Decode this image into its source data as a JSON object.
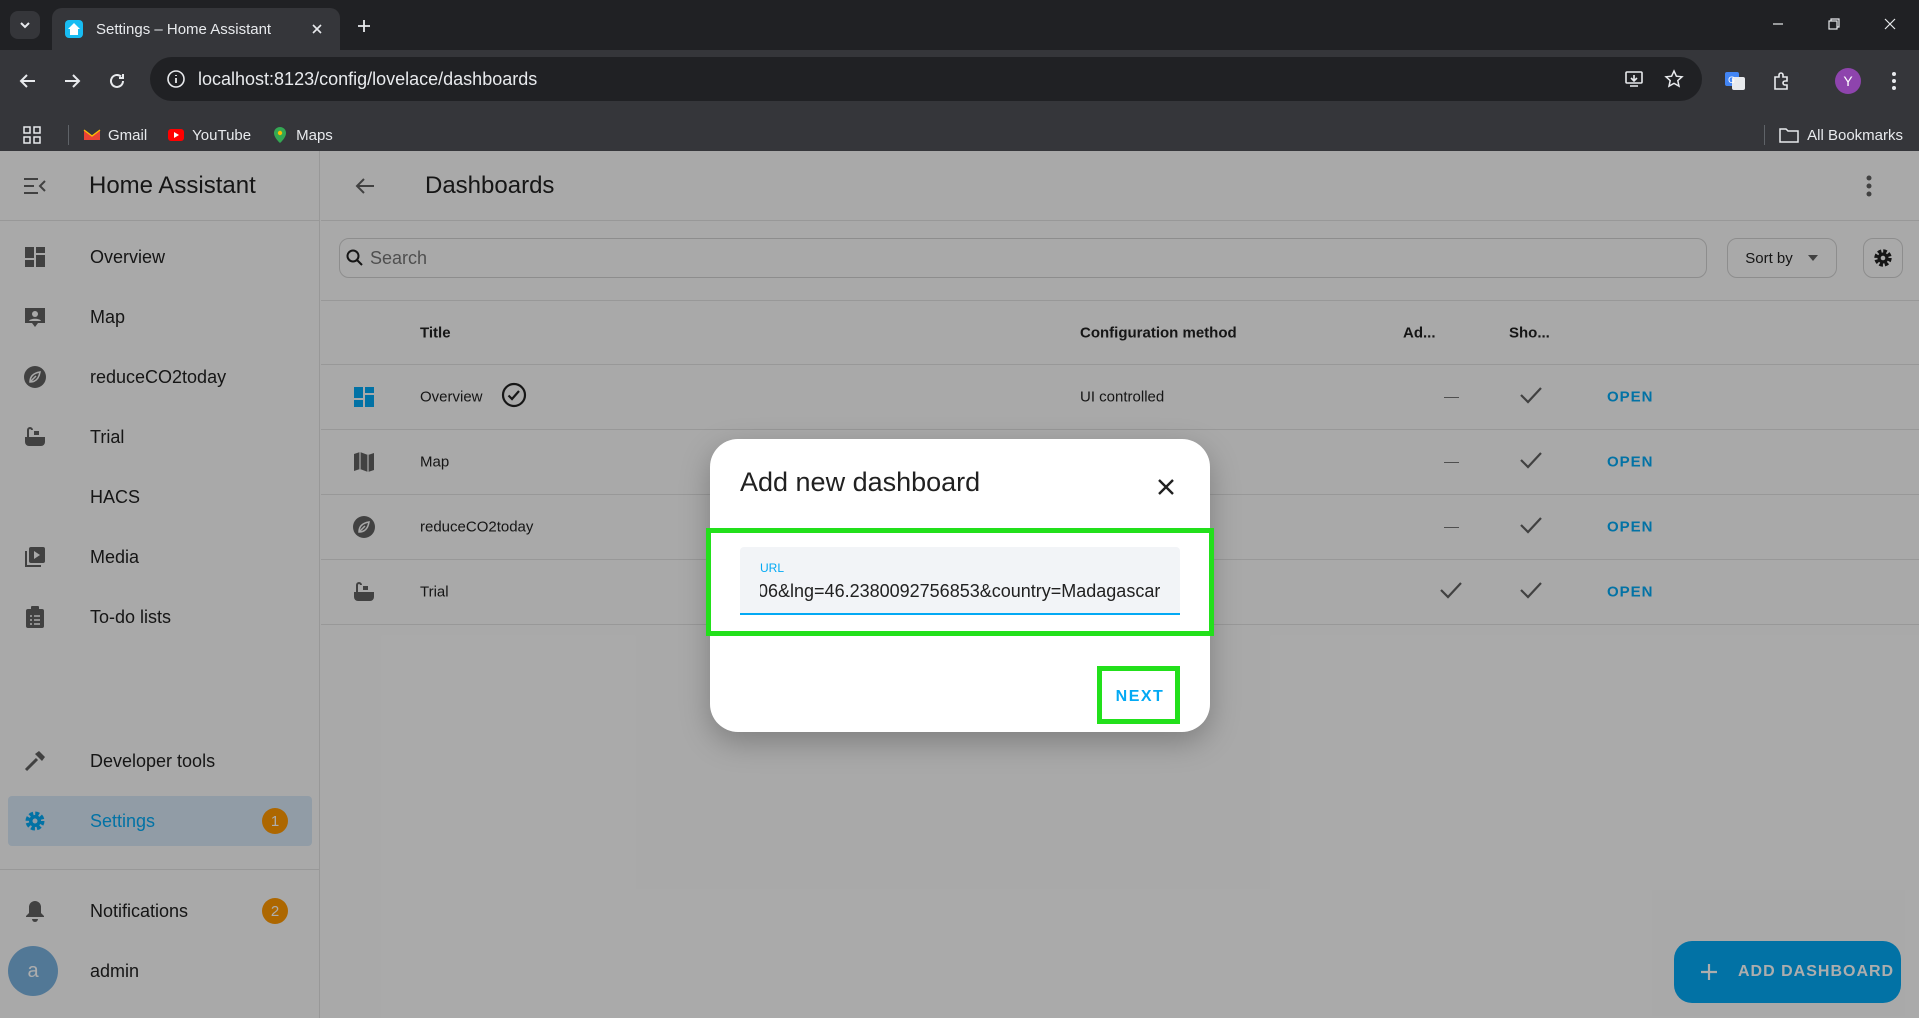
{
  "browser": {
    "tab_title": "Settings – Home Assistant",
    "url": "localhost:8123/config/lovelace/dashboards",
    "profile_initial": "Y",
    "bookmarks": [
      "Gmail",
      "YouTube",
      "Maps"
    ],
    "all_bookmarks": "All Bookmarks"
  },
  "sidebar": {
    "title": "Home Assistant",
    "items": [
      {
        "label": "Overview",
        "icon": "dashboard-icon"
      },
      {
        "label": "Map",
        "icon": "account-box-icon"
      },
      {
        "label": "reduceCO2today",
        "icon": "leaf-icon"
      },
      {
        "label": "Trial",
        "icon": "bathtub-icon"
      },
      {
        "label": "HACS",
        "icon": "hacs-icon"
      },
      {
        "label": "Media",
        "icon": "media-icon"
      },
      {
        "label": "To-do lists",
        "icon": "clipboard-icon"
      }
    ],
    "developer_tools": "Developer tools",
    "settings": "Settings",
    "settings_badge": "1",
    "notifications": "Notifications",
    "notifications_badge": "2",
    "user_name": "admin",
    "user_initial": "a"
  },
  "page": {
    "title": "Dashboards",
    "search_placeholder": "Search",
    "sort_label": "Sort by"
  },
  "table": {
    "headers": {
      "title": "Title",
      "config": "Configuration method",
      "admin": "Ad...",
      "show": "Sho..."
    },
    "rows": [
      {
        "title": "Overview",
        "config": "UI controlled",
        "admin": "—",
        "show": "check",
        "action": "OPEN"
      },
      {
        "title": "Map",
        "config": "",
        "admin": "—",
        "show": "check",
        "action": "OPEN"
      },
      {
        "title": "reduceCO2today",
        "config": "",
        "admin": "—",
        "show": "check",
        "action": "OPEN"
      },
      {
        "title": "Trial",
        "config": "",
        "admin": "check",
        "show": "check",
        "action": "OPEN"
      }
    ]
  },
  "fab": {
    "label": "ADD DASHBOARD"
  },
  "dialog": {
    "title": "Add new dashboard",
    "field_label": "URL",
    "field_value": "06&lng=46.2380092756853&country=Madagascar",
    "next_label": "NEXT"
  },
  "colors": {
    "accent": "#03a9f4",
    "badge": "#ff9800",
    "highlight": "#22e01b"
  }
}
